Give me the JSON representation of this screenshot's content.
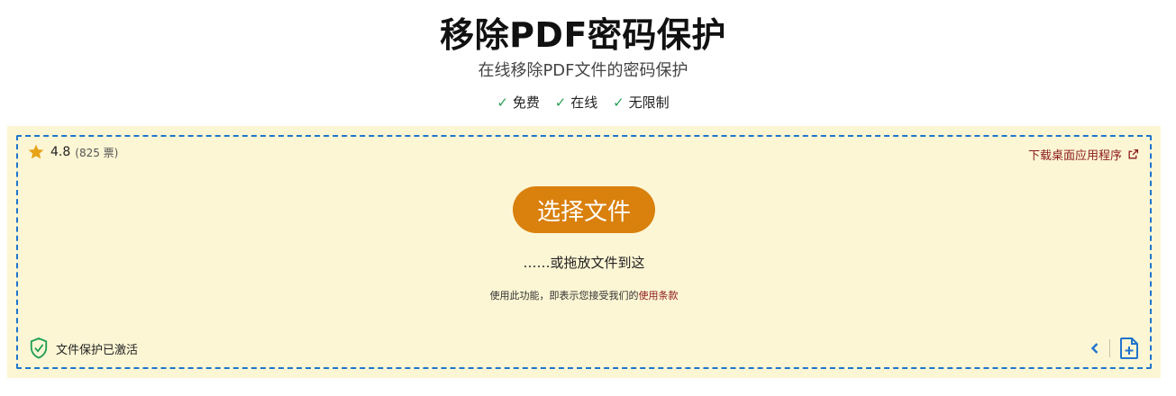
{
  "header": {
    "title": "移除PDF密码保护",
    "subtitle": "在线移除PDF文件的密码保护",
    "features": [
      "免费",
      "在线",
      "无限制"
    ],
    "check_glyph": "✓"
  },
  "upload": {
    "rating": {
      "value": "4.8",
      "votes": "(825 票)",
      "icon": "star-icon"
    },
    "desktop_link": "下载桌面应用程序",
    "choose_button": "选择文件",
    "drop_text": "……或拖放文件到这",
    "terms_prefix": "使用此功能，即表示您接受我们的",
    "terms_link": "使用条款",
    "protection_status": "文件保护已激活"
  },
  "colors": {
    "accent": "#d9800d",
    "dropzone_border": "#1f74cc",
    "dropzone_bg": "#fdf6d4",
    "link": "#8a1a1a",
    "check": "#2a9d55",
    "star": "#e8a317"
  }
}
